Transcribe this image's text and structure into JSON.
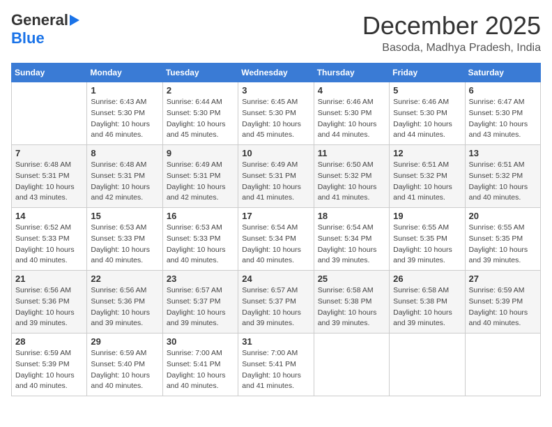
{
  "logo": {
    "line1": "General",
    "line2": "Blue"
  },
  "title": "December 2025",
  "location": "Basoda, Madhya Pradesh, India",
  "weekdays": [
    "Sunday",
    "Monday",
    "Tuesday",
    "Wednesday",
    "Thursday",
    "Friday",
    "Saturday"
  ],
  "weeks": [
    [
      {
        "day": "",
        "info": ""
      },
      {
        "day": "1",
        "info": "Sunrise: 6:43 AM\nSunset: 5:30 PM\nDaylight: 10 hours\nand 46 minutes."
      },
      {
        "day": "2",
        "info": "Sunrise: 6:44 AM\nSunset: 5:30 PM\nDaylight: 10 hours\nand 45 minutes."
      },
      {
        "day": "3",
        "info": "Sunrise: 6:45 AM\nSunset: 5:30 PM\nDaylight: 10 hours\nand 45 minutes."
      },
      {
        "day": "4",
        "info": "Sunrise: 6:46 AM\nSunset: 5:30 PM\nDaylight: 10 hours\nand 44 minutes."
      },
      {
        "day": "5",
        "info": "Sunrise: 6:46 AM\nSunset: 5:30 PM\nDaylight: 10 hours\nand 44 minutes."
      },
      {
        "day": "6",
        "info": "Sunrise: 6:47 AM\nSunset: 5:30 PM\nDaylight: 10 hours\nand 43 minutes."
      }
    ],
    [
      {
        "day": "7",
        "info": "Sunrise: 6:48 AM\nSunset: 5:31 PM\nDaylight: 10 hours\nand 43 minutes."
      },
      {
        "day": "8",
        "info": "Sunrise: 6:48 AM\nSunset: 5:31 PM\nDaylight: 10 hours\nand 42 minutes."
      },
      {
        "day": "9",
        "info": "Sunrise: 6:49 AM\nSunset: 5:31 PM\nDaylight: 10 hours\nand 42 minutes."
      },
      {
        "day": "10",
        "info": "Sunrise: 6:49 AM\nSunset: 5:31 PM\nDaylight: 10 hours\nand 41 minutes."
      },
      {
        "day": "11",
        "info": "Sunrise: 6:50 AM\nSunset: 5:32 PM\nDaylight: 10 hours\nand 41 minutes."
      },
      {
        "day": "12",
        "info": "Sunrise: 6:51 AM\nSunset: 5:32 PM\nDaylight: 10 hours\nand 41 minutes."
      },
      {
        "day": "13",
        "info": "Sunrise: 6:51 AM\nSunset: 5:32 PM\nDaylight: 10 hours\nand 40 minutes."
      }
    ],
    [
      {
        "day": "14",
        "info": "Sunrise: 6:52 AM\nSunset: 5:33 PM\nDaylight: 10 hours\nand 40 minutes."
      },
      {
        "day": "15",
        "info": "Sunrise: 6:53 AM\nSunset: 5:33 PM\nDaylight: 10 hours\nand 40 minutes."
      },
      {
        "day": "16",
        "info": "Sunrise: 6:53 AM\nSunset: 5:33 PM\nDaylight: 10 hours\nand 40 minutes."
      },
      {
        "day": "17",
        "info": "Sunrise: 6:54 AM\nSunset: 5:34 PM\nDaylight: 10 hours\nand 40 minutes."
      },
      {
        "day": "18",
        "info": "Sunrise: 6:54 AM\nSunset: 5:34 PM\nDaylight: 10 hours\nand 39 minutes."
      },
      {
        "day": "19",
        "info": "Sunrise: 6:55 AM\nSunset: 5:35 PM\nDaylight: 10 hours\nand 39 minutes."
      },
      {
        "day": "20",
        "info": "Sunrise: 6:55 AM\nSunset: 5:35 PM\nDaylight: 10 hours\nand 39 minutes."
      }
    ],
    [
      {
        "day": "21",
        "info": "Sunrise: 6:56 AM\nSunset: 5:36 PM\nDaylight: 10 hours\nand 39 minutes."
      },
      {
        "day": "22",
        "info": "Sunrise: 6:56 AM\nSunset: 5:36 PM\nDaylight: 10 hours\nand 39 minutes."
      },
      {
        "day": "23",
        "info": "Sunrise: 6:57 AM\nSunset: 5:37 PM\nDaylight: 10 hours\nand 39 minutes."
      },
      {
        "day": "24",
        "info": "Sunrise: 6:57 AM\nSunset: 5:37 PM\nDaylight: 10 hours\nand 39 minutes."
      },
      {
        "day": "25",
        "info": "Sunrise: 6:58 AM\nSunset: 5:38 PM\nDaylight: 10 hours\nand 39 minutes."
      },
      {
        "day": "26",
        "info": "Sunrise: 6:58 AM\nSunset: 5:38 PM\nDaylight: 10 hours\nand 39 minutes."
      },
      {
        "day": "27",
        "info": "Sunrise: 6:59 AM\nSunset: 5:39 PM\nDaylight: 10 hours\nand 40 minutes."
      }
    ],
    [
      {
        "day": "28",
        "info": "Sunrise: 6:59 AM\nSunset: 5:39 PM\nDaylight: 10 hours\nand 40 minutes."
      },
      {
        "day": "29",
        "info": "Sunrise: 6:59 AM\nSunset: 5:40 PM\nDaylight: 10 hours\nand 40 minutes."
      },
      {
        "day": "30",
        "info": "Sunrise: 7:00 AM\nSunset: 5:41 PM\nDaylight: 10 hours\nand 40 minutes."
      },
      {
        "day": "31",
        "info": "Sunrise: 7:00 AM\nSunset: 5:41 PM\nDaylight: 10 hours\nand 41 minutes."
      },
      {
        "day": "",
        "info": ""
      },
      {
        "day": "",
        "info": ""
      },
      {
        "day": "",
        "info": ""
      }
    ]
  ]
}
